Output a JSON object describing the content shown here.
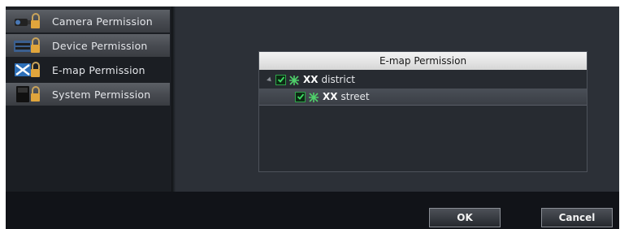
{
  "sidebar": {
    "items": [
      {
        "label": "Camera Permission",
        "icon": "camera-lock-icon",
        "state": "inactive"
      },
      {
        "label": "Device Permission",
        "icon": "device-lock-icon",
        "state": "inactive"
      },
      {
        "label": "E-map Permission",
        "icon": "emap-icon",
        "state": "active"
      },
      {
        "label": "System Permission",
        "icon": "system-lock-icon",
        "state": "inactive"
      }
    ]
  },
  "tree": {
    "header": "E-map Permission",
    "nodes": [
      {
        "prefix": "XX",
        "label": "district",
        "checked": true,
        "expanded": true
      },
      {
        "prefix": "XX",
        "label": "street",
        "checked": true,
        "selected": true
      }
    ]
  },
  "footer": {
    "ok_label": "OK",
    "cancel_label": "Cancel"
  },
  "colors": {
    "check_green": "#2fa34a",
    "background": "#2c3037"
  }
}
